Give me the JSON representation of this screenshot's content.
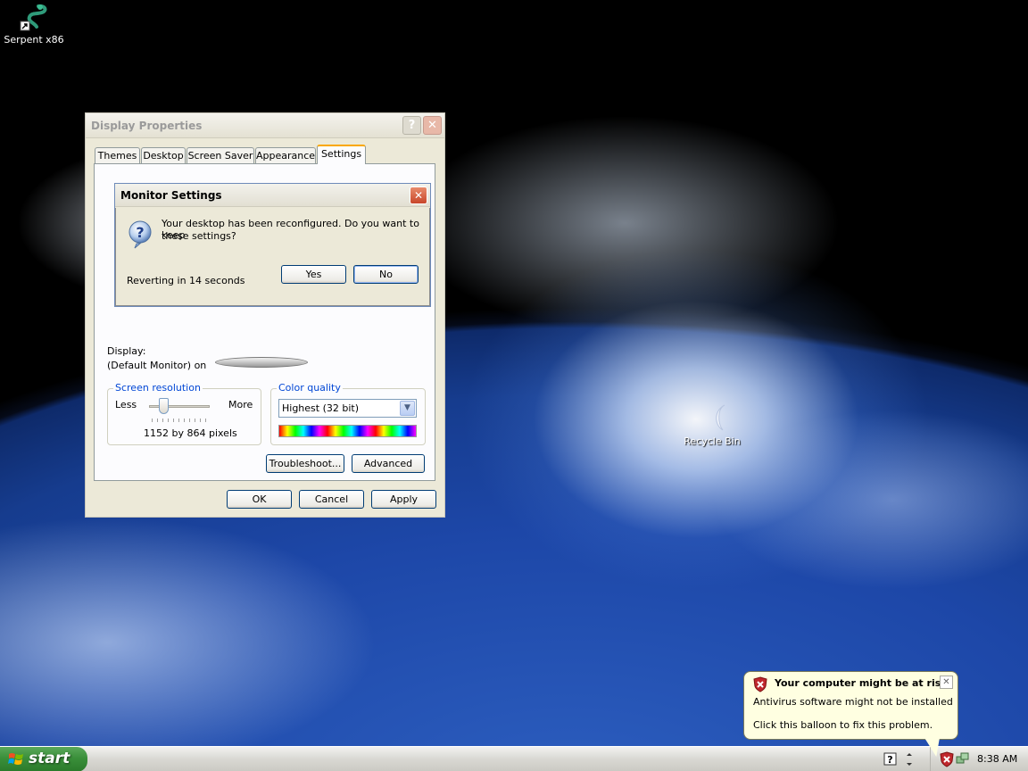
{
  "desktop": {
    "icons": [
      {
        "label": "Serpent x86"
      },
      {
        "label": "Recycle Bin"
      }
    ]
  },
  "display_properties": {
    "title": "Display Properties",
    "tabs": [
      "Themes",
      "Desktop",
      "Screen Saver",
      "Appearance",
      "Settings"
    ],
    "active_tab": "Settings",
    "display_label": "Display:",
    "display_value": "(Default Monitor) on",
    "screen_resolution": {
      "title": "Screen resolution",
      "less_label": "Less",
      "more_label": "More",
      "value_text": "1152 by 864 pixels",
      "slider_position": 0.2
    },
    "color_quality": {
      "title": "Color quality",
      "selected": "Highest (32 bit)"
    },
    "buttons": {
      "troubleshoot": "Troubleshoot...",
      "advanced": "Advanced",
      "ok": "OK",
      "cancel": "Cancel",
      "apply": "Apply"
    }
  },
  "monitor_settings": {
    "title": "Monitor Settings",
    "message_line1": "Your desktop has been reconfigured.  Do you want to keep",
    "message_line2": "these settings?",
    "countdown": "Reverting in 14 seconds",
    "yes_label": "Yes",
    "no_label": "No"
  },
  "taskbar": {
    "start_label": "start",
    "clock": "8:38 AM"
  },
  "balloon": {
    "title": "Your computer might be at risk",
    "line1": "Antivirus software might not be installed",
    "line2": "Click this balloon to fix this problem."
  },
  "colors": {
    "xp_blue_title": "#0046d5",
    "start_green": "#3a8f3a",
    "balloon_bg": "#ffffe1",
    "close_red": "#c8462a",
    "tab_highlight": "#f9a800"
  }
}
